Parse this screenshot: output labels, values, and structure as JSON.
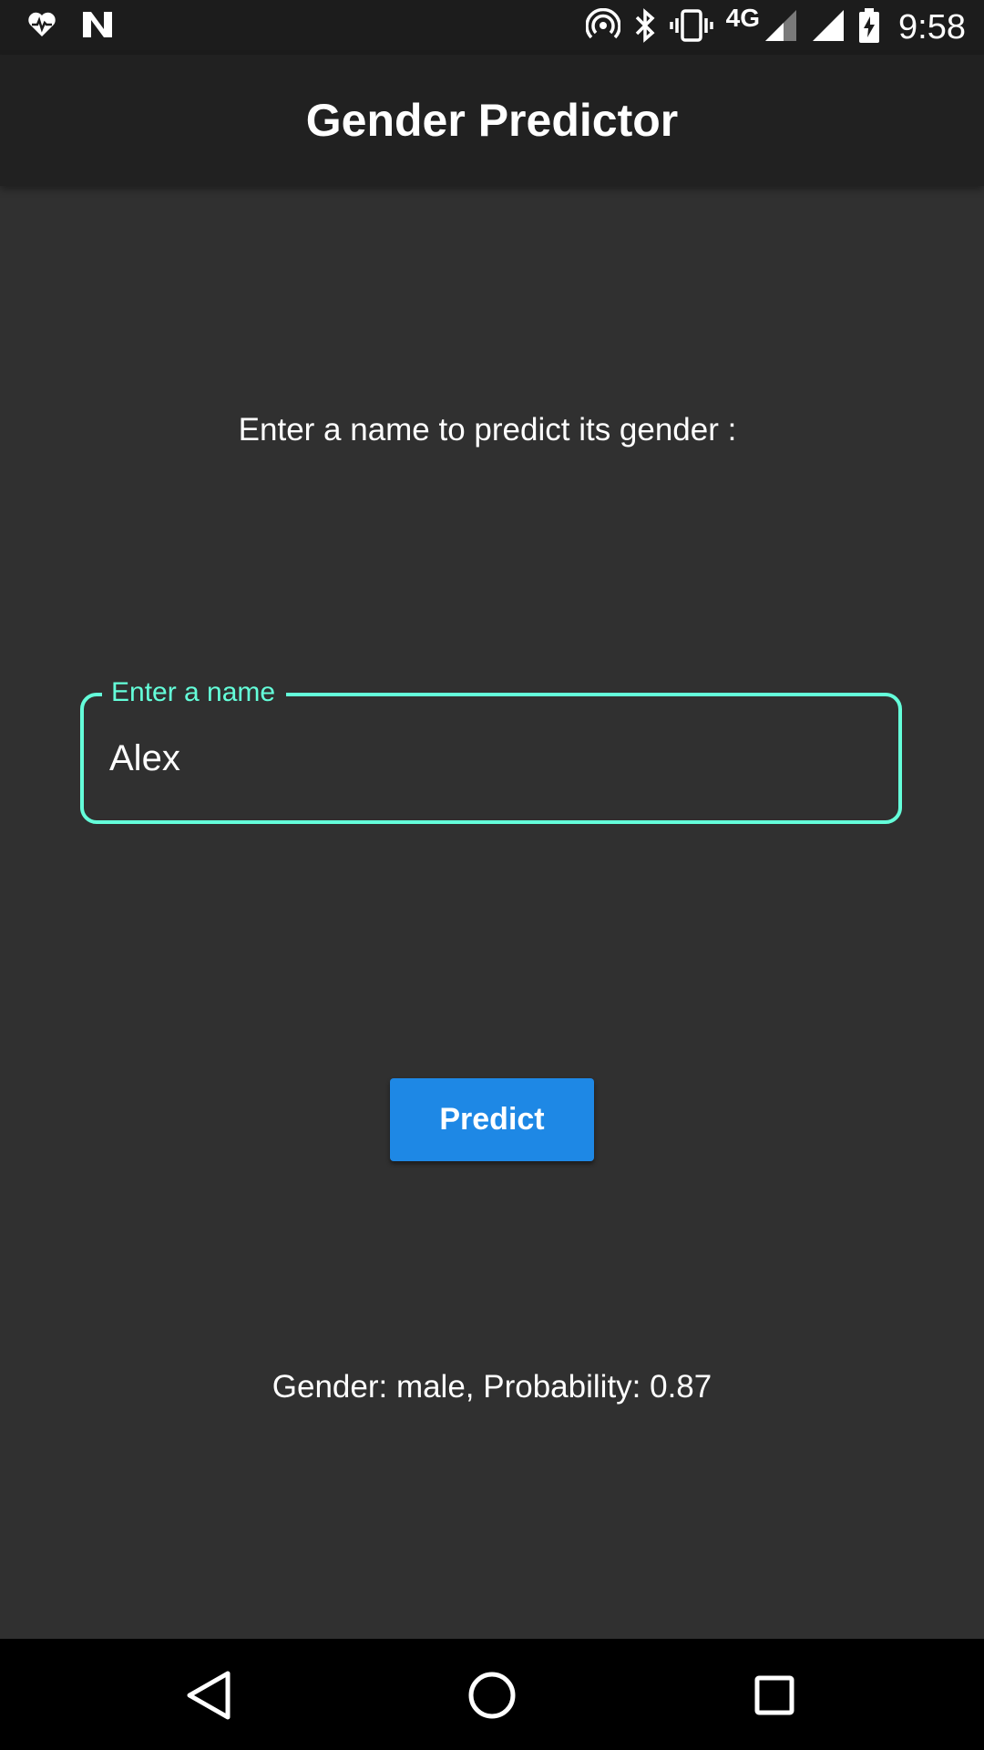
{
  "status_bar": {
    "left_icons": [
      "heart-pulse-icon",
      "n-notification-icon"
    ],
    "right_icons": [
      "hotspot-icon",
      "bluetooth-icon",
      "vibrate-icon",
      "signal-4g-icon",
      "signal-icon",
      "battery-charging-icon"
    ],
    "network": "4G",
    "time": "9:58"
  },
  "app_bar": {
    "title": "Gender Predictor"
  },
  "main": {
    "prompt": "Enter a name to predict its gender :",
    "name_field": {
      "label": "Enter a name",
      "value": "Alex"
    },
    "predict_label": "Predict",
    "result": "Gender: male, Probability: 0.87"
  },
  "nav_bar": {
    "icons": [
      "back-icon",
      "home-icon",
      "recents-icon"
    ]
  },
  "colors": {
    "background": "#303030",
    "app_bar": "#212121",
    "accent": "#64ffda",
    "button": "#1e88e5"
  }
}
